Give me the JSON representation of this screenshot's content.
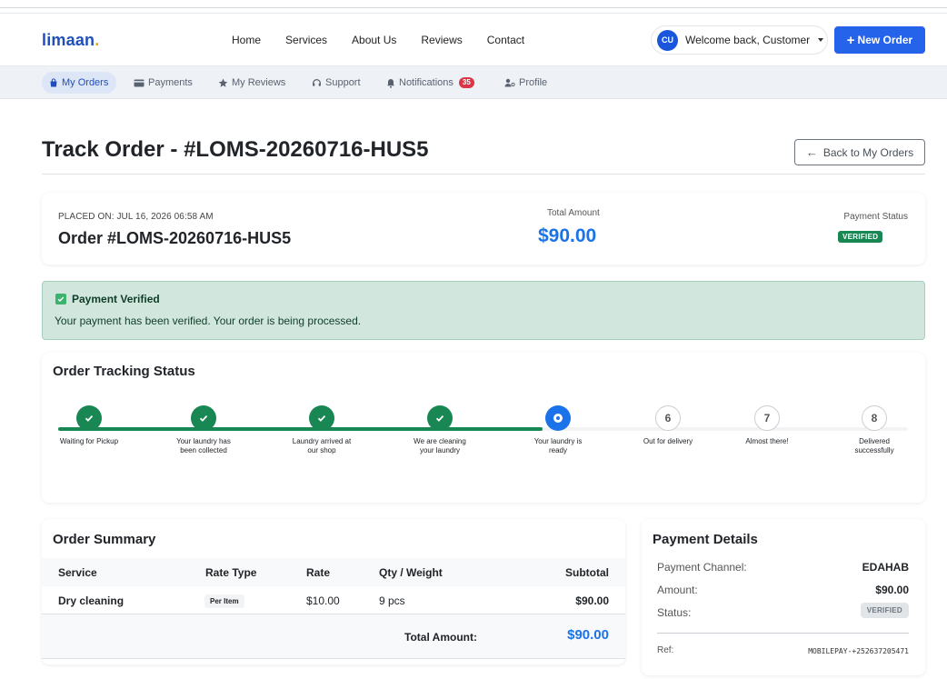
{
  "brand": {
    "name": "limaan",
    "dot": "."
  },
  "nav": {
    "links": [
      "Home",
      "Services",
      "About Us",
      "Reviews",
      "Contact"
    ],
    "avatar_initials": "CU",
    "welcome": "Welcome back, Customer",
    "new_order": "New Order"
  },
  "subnav": {
    "my_orders": "My Orders",
    "payments": "Payments",
    "my_reviews": "My Reviews",
    "support": "Support",
    "notifications": "Notifications",
    "notifications_count": "35",
    "profile": "Profile"
  },
  "page": {
    "title": "Track Order - #LOMS-20260716-HUS5",
    "back_button": "Back to My Orders"
  },
  "order": {
    "placed_on": "PLACED ON: JUL 16, 2026 06:58 AM",
    "number": "Order #LOMS-20260716-HUS5",
    "total_label": "Total Amount",
    "total_value": "$90.00",
    "payment_status_label": "Payment Status",
    "payment_status": "VERIFIED"
  },
  "alert": {
    "title": "Payment Verified",
    "text": "Your payment has been verified. Your order is being processed."
  },
  "tracking": {
    "title": "Order Tracking Status",
    "progress_fraction": 0.57,
    "steps": [
      {
        "label": "Waiting for Pickup",
        "state": "done",
        "number": ""
      },
      {
        "label": "Your laundry has been collected",
        "state": "done",
        "number": ""
      },
      {
        "label": "Laundry arrived at our shop",
        "state": "done",
        "number": ""
      },
      {
        "label": "We are cleaning your laundry",
        "state": "done",
        "number": ""
      },
      {
        "label": "Your laundry is ready",
        "state": "current",
        "number": ""
      },
      {
        "label": "Out for delivery",
        "state": "pending",
        "number": "6"
      },
      {
        "label": "Almost there!",
        "state": "pending",
        "number": "7"
      },
      {
        "label": "Delivered successfully",
        "state": "pending",
        "number": "8"
      }
    ]
  },
  "summary": {
    "title": "Order Summary",
    "headers": {
      "service": "Service",
      "rate_type": "Rate Type",
      "rate": "Rate",
      "qty": "Qty / Weight",
      "subtotal": "Subtotal"
    },
    "rows": [
      {
        "service": "Dry cleaning",
        "rate_type": "Per Item",
        "rate": "$10.00",
        "qty": "9 pcs",
        "subtotal": "$90.00"
      }
    ],
    "total_label": "Total Amount:",
    "total_value": "$90.00"
  },
  "payment": {
    "title": "Payment Details",
    "channel_label": "Payment Channel:",
    "channel_value": "EDAHAB",
    "amount_label": "Amount:",
    "amount_value": "$90.00",
    "status_label": "Status:",
    "status_value": "VERIFIED",
    "ref_label": "Ref:",
    "ref_value": "MOBILEPAY-+252637205471"
  },
  "colors": {
    "primary": "#2563eb",
    "brand": "#1f4fb8",
    "success": "#198754",
    "danger": "#dc3545",
    "amount_blue": "#1a73e8"
  }
}
